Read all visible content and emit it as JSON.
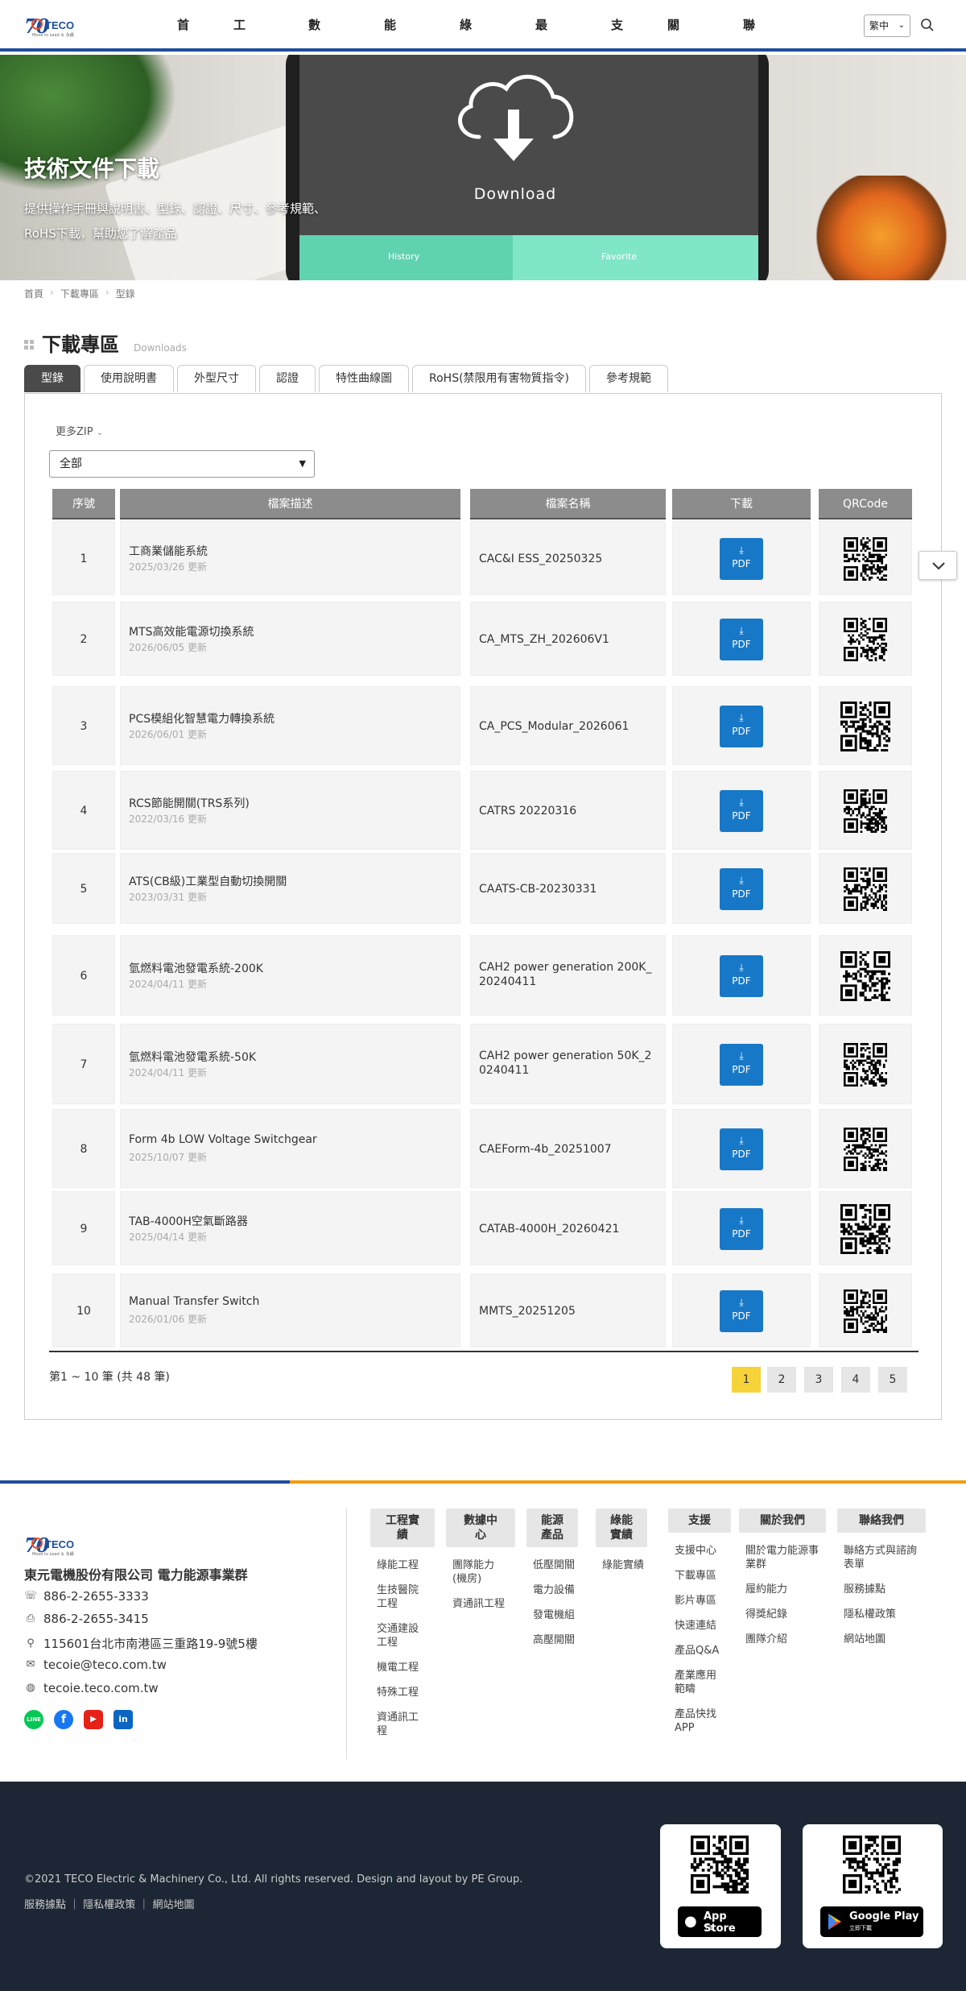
{
  "header": {
    "logo_text": "TECO",
    "logo_number": "70",
    "logo_tagline": "Move to Lead ＆ 永續",
    "nav": [
      "首頁",
      "工程實績",
      "數據中心",
      "能源產品",
      "綠能實績",
      "最新消息",
      "支援",
      "關於我們",
      "聯絡我們"
    ],
    "language": "繁中"
  },
  "hero": {
    "title": "技術文件下載",
    "desc_line1": "提供操作手冊與說明書、型錄、認證、尺寸、參考規範、",
    "desc_line2": "RoHS下載，幫助您了解產品",
    "download_text": "Download",
    "history": "History",
    "favorite": "Favorite"
  },
  "breadcrumb": [
    "首頁",
    "下載專區",
    "型錄"
  ],
  "page": {
    "title": "下載專區",
    "subtitle": "Downloads"
  },
  "tabs": [
    "型錄",
    "使用說明書",
    "外型尺寸",
    "認證",
    "特性曲線圖",
    "RoHS(禁限用有害物質指令)",
    "參考規範"
  ],
  "filter": {
    "more_zip": "更多ZIP",
    "selected": "全部"
  },
  "table": {
    "headers": [
      "序號",
      "檔案描述",
      "檔案名稱",
      "下載",
      "QRCode"
    ],
    "pdf_label": "PDF",
    "rows": [
      {
        "no": "1",
        "title": "工商業儲能系統",
        "date": "2025/03/26 更新",
        "file1": "CAC&I ESS_20250325",
        "file2": ""
      },
      {
        "no": "2",
        "title": "MTS高效能電源切換系統",
        "date": "2026/06/05 更新",
        "file1": "CA_MTS_ZH_202606V1",
        "file2": ""
      },
      {
        "no": "3",
        "title": "PCS模組化智慧電力轉換系統",
        "date": "2026/06/01 更新",
        "file1": "CA_PCS_Modular_2026061",
        "file2": ""
      },
      {
        "no": "4",
        "title": "RCS節能開關(TRS系列)",
        "date": "2022/03/16 更新",
        "file1": "CATRS 20220316",
        "file2": ""
      },
      {
        "no": "5",
        "title": "ATS(CB級)工業型自動切換開關",
        "date": "2023/03/31 更新",
        "file1": "CAATS-CB-20230331",
        "file2": ""
      },
      {
        "no": "6",
        "title": "氫燃料電池發電系統-200K",
        "date": "2024/04/11 更新",
        "file1": "CAH2 power generation 200K_",
        "file2": "20240411"
      },
      {
        "no": "7",
        "title": "氫燃料電池發電系統-50K",
        "date": "2024/04/11 更新",
        "file1": "CAH2 power generation 50K_2",
        "file2": "0240411"
      },
      {
        "no": "8",
        "title": "Form 4b LOW Voltage Switchgear",
        "date": "2025/10/07 更新",
        "file1": "CAEForm-4b_20251007",
        "file2": ""
      },
      {
        "no": "9",
        "title": "TAB-4000H空氣斷路器",
        "date": "2025/04/14 更新",
        "file1": "CATAB-4000H_20260421",
        "file2": ""
      },
      {
        "no": "10",
        "title": "Manual Transfer Switch",
        "date": "2026/01/06 更新",
        "file1": "MMTS_20251205",
        "file2": ""
      }
    ],
    "count_text": "第1 ~ 10 筆 (共 48 筆)",
    "pages": [
      "1",
      "2",
      "3",
      "4",
      "5"
    ]
  },
  "footer": {
    "company": "東元電機股份有限公司 電力能源事業群",
    "phone": "886-2-2655-3333",
    "fax": "886-2-2655-3415",
    "address": "115601台北市南港區三重路19-9號5樓",
    "email": "tecoie@teco.com.tw",
    "website": "tecoie.teco.com.tw",
    "social": [
      "LINE",
      "f",
      "▶",
      "in"
    ],
    "columns": [
      {
        "h1": "工程實",
        "h2": "績",
        "items": [
          [
            "綠能工程"
          ],
          [
            "生技醫院",
            "工程"
          ],
          [
            "交通建設",
            "工程"
          ],
          [
            "機電工程"
          ],
          [
            "特殊工程"
          ],
          [
            "資通訊工",
            "程"
          ]
        ]
      },
      {
        "h1": "數據中",
        "h2": "心",
        "items": [
          [
            "團隊能力",
            "(機房)"
          ],
          [
            "資通訊工程"
          ]
        ]
      },
      {
        "h1": "能源",
        "h2": "產品",
        "items": [
          [
            "低壓開關"
          ],
          [
            "電力設備"
          ],
          [
            "發電機組"
          ],
          [
            "高壓開關"
          ]
        ]
      },
      {
        "h1": "綠能",
        "h2": "實績",
        "items": [
          [
            "綠能實績"
          ]
        ]
      },
      {
        "h1": "支援",
        "h2": "",
        "items": [
          [
            "支援中心"
          ],
          [
            "下載專區"
          ],
          [
            "影片專區"
          ],
          [
            "快速連結"
          ],
          [
            "產品Q&A"
          ],
          [
            "產業應用",
            "範疇"
          ],
          [
            "產品快找",
            "APP"
          ]
        ]
      },
      {
        "h1": "關於我們",
        "h2": "",
        "items": [
          [
            "關於電力能源事",
            "業群"
          ],
          [
            "履約能力"
          ],
          [
            "得獎紀錄"
          ],
          [
            "團隊介紹"
          ]
        ]
      },
      {
        "h1": "聯絡我們",
        "h2": "",
        "items": [
          [
            "聯絡方式與諮詢",
            "表單"
          ],
          [
            "服務據點"
          ],
          [
            "隱私權政策"
          ],
          [
            "網站地圖"
          ]
        ]
      }
    ],
    "copyright": "©2021 TECO Electric & Machinery Co., Ltd. All rights reserved. Design and layout by PE Group.",
    "links": "服務據點 ｜ 隱私權政策 ｜ 網站地圖",
    "app_store": {
      "name": "App Store",
      "sub": "下載"
    },
    "google_play": {
      "name": "Google Play",
      "sub": "立即下載"
    }
  }
}
